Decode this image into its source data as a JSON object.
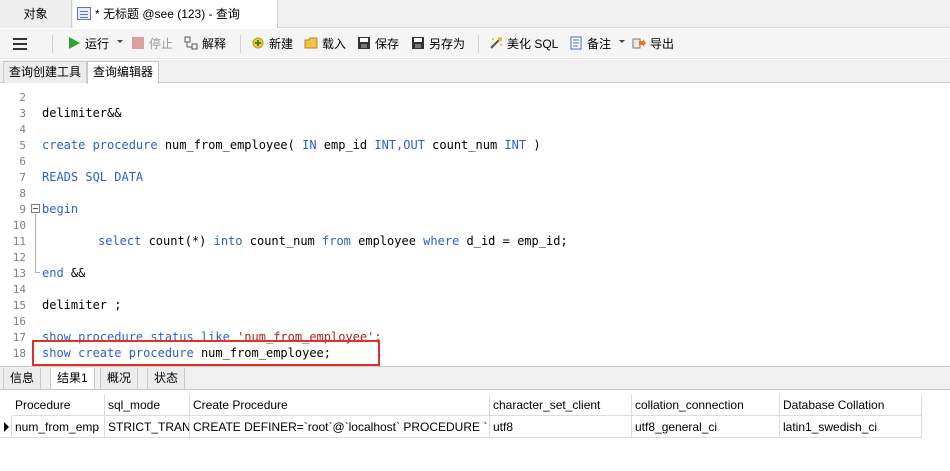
{
  "tabs": {
    "objects": "对象",
    "query": "* 无标题 @see (123) - 查询"
  },
  "toolbar": {
    "run": "运行",
    "stop": "停止",
    "explain": "解释",
    "new": "新建",
    "load": "载入",
    "save": "保存",
    "save_as": "另存为",
    "beautify": "美化 SQL",
    "comment": "备注",
    "export": "导出"
  },
  "subtabs": {
    "builder": "查询创建工具",
    "editor": "查询编辑器"
  },
  "editor": {
    "line_numbers": [
      "2",
      "3",
      "4",
      "5",
      "6",
      "7",
      "8",
      "9",
      "10",
      "11",
      "12",
      "13",
      "14",
      "15",
      "16",
      "17",
      "18"
    ],
    "lines": {
      "l3": "delimiter&&",
      "l5_kw1": "create procedure",
      "l5_mid1": " num_from_employee( ",
      "l5_kw2": "IN",
      "l5_mid2": " emp_id ",
      "l5_kw3": "INT,OUT",
      "l5_mid3": " count_num ",
      "l5_kw4": "INT",
      "l5_end": " )",
      "l7": "READS SQL DATA",
      "l9": "begin",
      "l11_kw1": "select",
      "l11_mid1": " count(*) ",
      "l11_kw2": "into",
      "l11_mid2": " count_num ",
      "l11_kw3": "from",
      "l11_mid3": " employee ",
      "l11_kw4": "where",
      "l11_end": " d_id = emp_id;",
      "l13_kw": "end",
      "l13_end": " &&",
      "l15": "delimiter ;",
      "l17_kw": "show procedure status like",
      "l17_str": " 'num_from_employee';",
      "l18_kw": "show create procedure",
      "l18_end": " num_from_employee;"
    }
  },
  "bottom_tabs": {
    "info": "信息",
    "result": "结果1",
    "overview": "概况",
    "status": "状态"
  },
  "result": {
    "columns": [
      "Procedure",
      "sql_mode",
      "Create Procedure",
      "character_set_client",
      "collation_connection",
      "Database Collation"
    ],
    "row": [
      "num_from_emp",
      "STRICT_TRANS",
      "CREATE DEFINER=`root`@`localhost` PROCEDURE `",
      "utf8",
      "utf8_general_ci",
      "latin1_swedish_ci"
    ]
  },
  "colors": {
    "keyword": "#2b5fd9",
    "highlight_box": "#e0302a"
  }
}
